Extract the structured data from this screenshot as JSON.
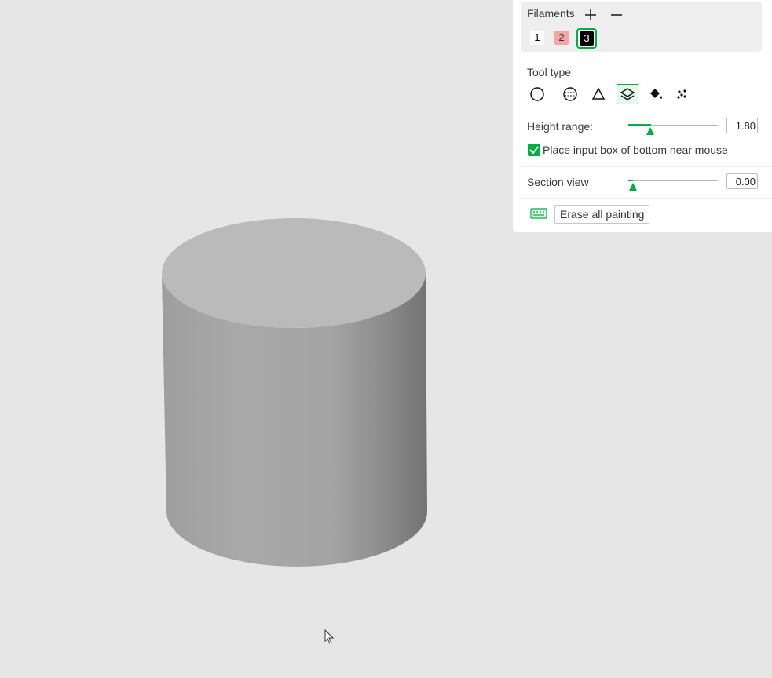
{
  "filaments": {
    "title": "Filaments",
    "add_icon": "plus-icon",
    "remove_icon": "minus-icon",
    "items": [
      {
        "label": "1",
        "color": "#ffffff"
      },
      {
        "label": "2",
        "color": "#f4a6a6"
      },
      {
        "label": "3",
        "color": "#000000",
        "selected": true
      }
    ]
  },
  "tool_type": {
    "title": "Tool type",
    "tools": [
      {
        "icon": "circle-tool-icon"
      },
      {
        "icon": "sphere-tool-icon"
      },
      {
        "icon": "triangle-tool-icon"
      },
      {
        "icon": "height-range-tool-icon",
        "active": true
      },
      {
        "icon": "fill-bucket-tool-icon"
      },
      {
        "icon": "gap-fill-tool-icon"
      }
    ]
  },
  "height_range": {
    "label": "Height range:",
    "value": "1.80",
    "slider_fraction": 0.25
  },
  "place_input": {
    "label": "Place input box of bottom near mouse",
    "checked": true
  },
  "section_view": {
    "label": "Section view",
    "value": "0.00",
    "slider_fraction": 0.05
  },
  "footer": {
    "keyboard_icon": "keyboard-icon",
    "erase_label": "Erase all painting"
  },
  "colors": {
    "accent": "#00ae42",
    "viewport_bg": "#e6e6e6",
    "model": "#a8a8a8"
  }
}
